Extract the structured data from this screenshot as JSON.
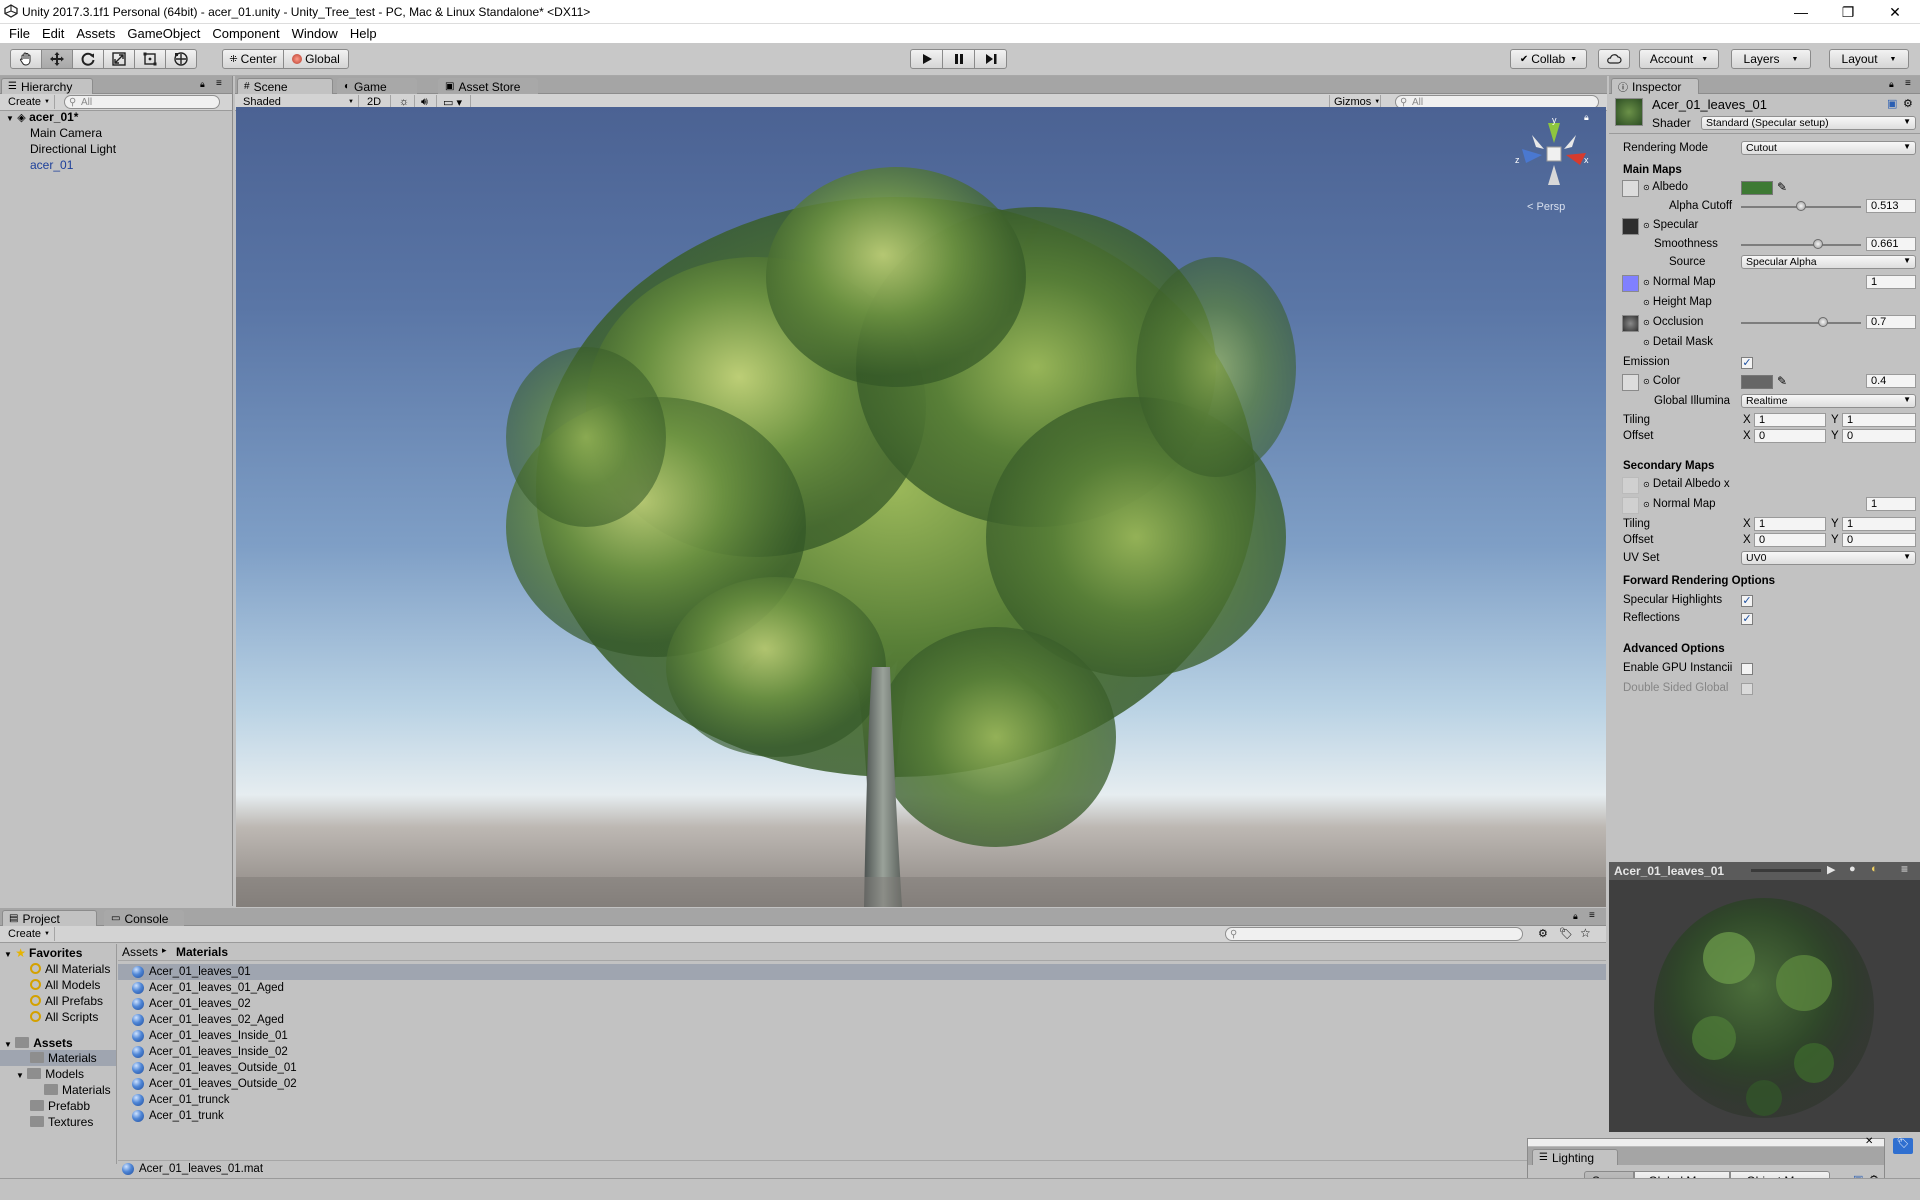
{
  "window": {
    "title": "Unity 2017.3.1f1 Personal (64bit) - acer_01.unity - Unity_Tree_test - PC, Mac & Linux Standalone* <DX11>",
    "minimize": "—",
    "maximize": "❐",
    "close": "✕"
  },
  "menu": [
    "File",
    "Edit",
    "Assets",
    "GameObject",
    "Component",
    "Window",
    "Help"
  ],
  "toolbar": {
    "pivot": "Center",
    "space": "Global",
    "collab": "Collab",
    "account": "Account",
    "layers": "Layers",
    "layout": "Layout"
  },
  "hierarchy": {
    "tab": "Hierarchy",
    "create": "Create",
    "search_placeholder": "All",
    "scene": "acer_01*",
    "items": [
      "Main Camera",
      "Directional Light",
      "acer_01"
    ]
  },
  "scene": {
    "tabs": [
      "Scene",
      "Game",
      "Asset Store"
    ],
    "shading": "Shaded",
    "mode2d": "2D",
    "gizmos": "Gizmos",
    "search_placeholder": "All",
    "projection": "Persp",
    "gizmo_axes": {
      "y": "y",
      "x": "x",
      "z": "z"
    }
  },
  "inspector": {
    "tab": "Inspector",
    "material": "Acer_01_leaves_01",
    "shader_label": "Shader",
    "shader": "Standard (Specular setup)",
    "rendering_mode_label": "Rendering Mode",
    "rendering_mode": "Cutout",
    "main_maps": "Main Maps",
    "albedo": "Albedo",
    "albedo_color": "#3e7a34",
    "alpha_cutoff_label": "Alpha Cutoff",
    "alpha_cutoff": "0.513",
    "specular": "Specular",
    "smoothness_label": "Smoothness",
    "smoothness": "0.661",
    "source_label": "Source",
    "source": "Specular Alpha",
    "normal_map": "Normal Map",
    "normal_map_value": "1",
    "height_map": "Height Map",
    "occlusion": "Occlusion",
    "occlusion_value": "0.7",
    "detail_mask": "Detail Mask",
    "emission": "Emission",
    "color": "Color",
    "emission_value": "0.4",
    "gi_label": "Global Illumina",
    "gi": "Realtime",
    "tiling": "Tiling",
    "offset": "Offset",
    "x": "X",
    "y": "Y",
    "tiling_x": "1",
    "tiling_y": "1",
    "offset_x": "0",
    "offset_y": "0",
    "secondary_maps": "Secondary Maps",
    "detail_albedo": "Detail Albedo x",
    "normal_map2": "Normal Map",
    "normal_map2_value": "1",
    "tiling2_x": "1",
    "tiling2_y": "1",
    "offset2_x": "0",
    "offset2_y": "0",
    "uv_set_label": "UV Set",
    "uv_set": "UV0",
    "forward_options": "Forward Rendering Options",
    "specular_highlights": "Specular Highlights",
    "reflections": "Reflections",
    "advanced_options": "Advanced Options",
    "gpu_instancing": "Enable GPU Instancii",
    "double_sided": "Double Sided Global"
  },
  "preview": {
    "title": "Acer_01_leaves_01"
  },
  "project": {
    "tabs": [
      "Project",
      "Console"
    ],
    "create": "Create",
    "favorites": "Favorites",
    "favorite_items": [
      "All Materials",
      "All Models",
      "All Prefabs",
      "All Scripts"
    ],
    "assets_root": "Assets",
    "folders": {
      "materials": "Materials",
      "models": "Models",
      "models_materials": "Materials",
      "prefabb": "Prefabb",
      "textures": "Textures"
    },
    "breadcrumb": {
      "root": "Assets",
      "sep": "▸",
      "current": "Materials"
    },
    "files": [
      "Acer_01_leaves_01",
      "Acer_01_leaves_01_Aged",
      "Acer_01_leaves_02",
      "Acer_01_leaves_02_Aged",
      "Acer_01_leaves_Inside_01",
      "Acer_01_leaves_Inside_02",
      "Acer_01_leaves_Outside_01",
      "Acer_01_leaves_Outside_02",
      "Acer_01_trunck",
      "Acer_01_trunk"
    ],
    "selected_file": "Acer_01_leaves_01.mat"
  },
  "lighting": {
    "title": "Lighting",
    "tabs": [
      "Scene",
      "Global Maps",
      "Object Maps"
    ]
  }
}
